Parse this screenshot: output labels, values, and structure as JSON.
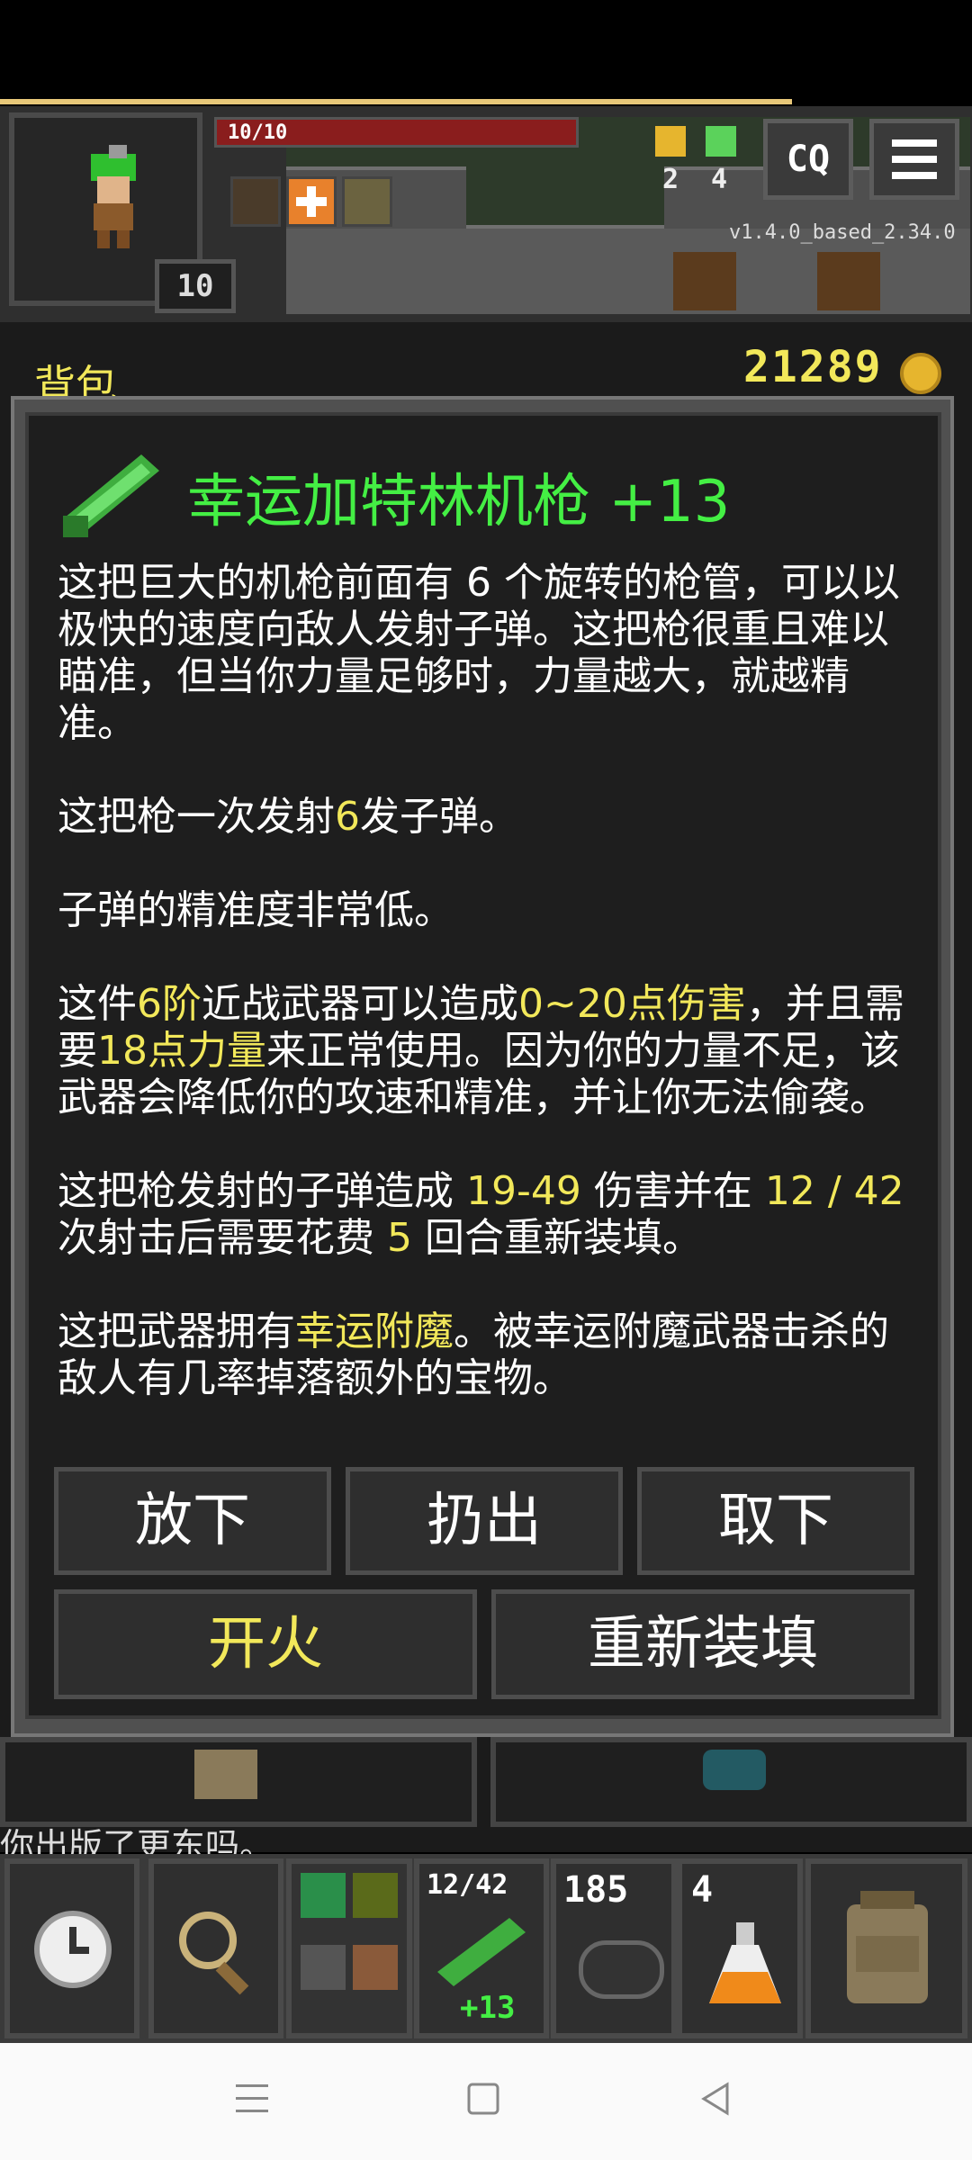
{
  "hud": {
    "hp_text": "10/10",
    "hero_level": "10",
    "version": "v1.4.0_based_2.34.0",
    "keys_count": "2",
    "depth_count": "4",
    "search_label": "CQ",
    "menu_icon": "hamburger-icon"
  },
  "bag": {
    "title": "背包",
    "gold": "21289"
  },
  "item": {
    "title": "幸运加特林机枪 +13",
    "p1": "这把巨大的机枪前面有 6 个旋转的枪管，可以以极快的速度向敌人发射子弹。这把枪很重且难以瞄准，但当你力量足够时，力量越大，就越精准。",
    "p2_a": "这把枪一次发射",
    "p2_h": "6",
    "p2_b": "发子弹。",
    "p3": "子弹的精准度非常低。",
    "p4_a": "这件",
    "p4_h1": "6阶",
    "p4_b": "近战武器可以造成",
    "p4_h2": "0~20点伤害",
    "p4_c": "，并且需要",
    "p4_h3": "18点力量",
    "p4_d": "来正常使用。因为你的力量不足，该武器会降低你的攻速和精准，并让你无法偷袭。",
    "p5_a": "这把枪发射的子弹造成 ",
    "p5_h1": "19-49",
    "p5_b": " 伤害并在 ",
    "p5_h2": "12 / 42",
    "p5_c": " 次射击后需要花费 ",
    "p5_h3": "5",
    "p5_d": " 回合重新装填。",
    "p6_a": "这把武器拥有",
    "p6_h": "幸运附魔",
    "p6_b": "。被幸运附魔武器击杀的敌人有几率掉落额外的宝物。"
  },
  "buttons": {
    "drop": "放下",
    "throw": "扔出",
    "unequip": "取下",
    "fire": "开火",
    "reload": "重新装填"
  },
  "log": {
    "partial_text": "你出版了更东吗。"
  },
  "quickbar": {
    "ammo": "12/42",
    "weapon_level": "+13",
    "stone_count": "185",
    "potion_count": "4"
  },
  "colors": {
    "accent_yellow": "#f2e85a",
    "item_green": "#44ef44"
  }
}
